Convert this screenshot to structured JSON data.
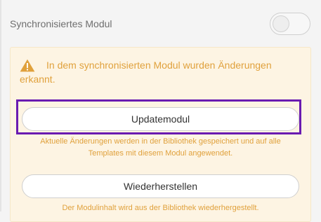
{
  "sync_module": {
    "label": "Synchronisiertes Modul",
    "toggle_on": false
  },
  "warning": {
    "icon": "warning-triangle-icon",
    "text_line1": "In dem synchronisierten Modul wurden Änderungen",
    "text_line2": "erkannt."
  },
  "update": {
    "button_label": "Updatemodul",
    "description": "Aktuelle Änderungen werden in der Bibliothek gespeichert und auf alle Templates mit diesem Modul angewendet."
  },
  "restore": {
    "button_label": "Wiederherstellen",
    "description": "Der Modulinhalt wird aus der Bibliothek wiederhergestellt."
  },
  "colors": {
    "warning": "#e0a13c",
    "panel_bg": "#fdf4e3",
    "highlight": "#6a1bb1"
  }
}
